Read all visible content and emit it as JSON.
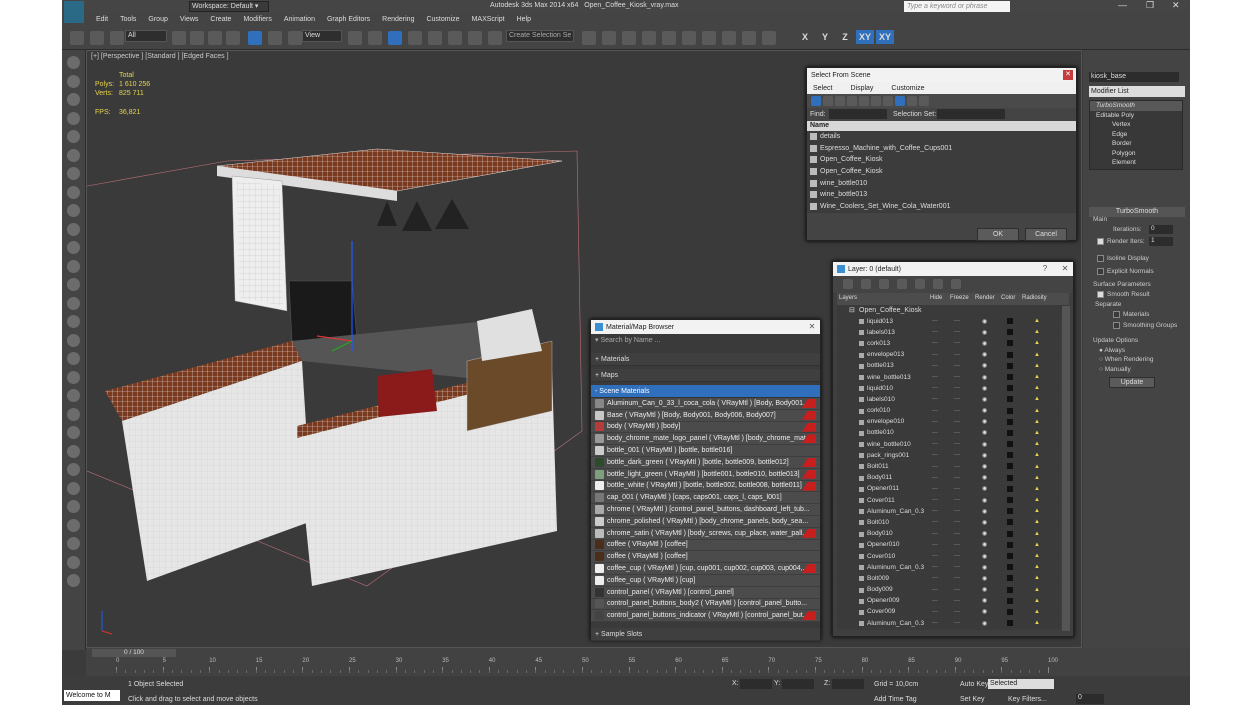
{
  "app": {
    "title": "Autodesk 3ds Max 2014 x64",
    "file": "Open_Coffee_Kiosk_vray.max",
    "workspace": "Workspace: Default",
    "search_placeholder": "Type a keyword or phrase"
  },
  "menu": [
    "Edit",
    "Tools",
    "Group",
    "Views",
    "Create",
    "Modifiers",
    "Animation",
    "Graph Editors",
    "Rendering",
    "Customize",
    "MAXScript",
    "Help"
  ],
  "toolbar": {
    "filter": "All",
    "refcoord": "View",
    "selset": "Create Selection Se",
    "axes": [
      "X",
      "Y",
      "Z",
      "XY",
      "XY"
    ]
  },
  "viewport": {
    "label": "[+] [Perspective ] [Standard ] [Edged Faces ]",
    "stats": {
      "total_label": "Total",
      "polys_label": "Polys:",
      "polys": "1 610 256",
      "verts_label": "Verts:",
      "verts": "825 711",
      "fps_label": "FPS:",
      "fps": "36,821"
    }
  },
  "select_dialog": {
    "title": "Select From Scene",
    "menu": [
      "Select",
      "Display",
      "Customize"
    ],
    "find_label": "Find:",
    "selset_label": "Selection Set:",
    "col_name": "Name",
    "items": [
      "details",
      "Espresso_Machine_with_Coffee_Cups001",
      "Open_Coffee_Kiosk",
      "Open_Coffee_Kiosk",
      "wine_bottle010",
      "wine_bottle013",
      "Wine_Coolers_Set_Wine_Cola_Water001"
    ],
    "ok": "OK",
    "cancel": "Cancel"
  },
  "material_browser": {
    "title": "Material/Map Browser",
    "search": "Search by Name ...",
    "sections": [
      "+ Materials",
      "+ Maps",
      "- Scene Materials"
    ],
    "footer": "+ Sample Slots",
    "materials": [
      "Aluminum_Can_0_33_l_coca_cola  ( VRayMtl ) [Body, Body001,...",
      "Base  ( VRayMtl ) [Body, Body001, Body006, Body007]",
      "body  ( VRayMtl ) [body]",
      "body_chrome_mate_logo_panel  ( VRayMtl ) [body_chrome_mat...",
      "bottle_001  ( VRayMtl ) [bottle, bottle016]",
      "bottle_dark_green  ( VRayMtl ) [bottle, bottle009, bottle012]",
      "bottle_light_green  ( VRayMtl ) [bottle001, bottle010, bottle013]",
      "bottle_white  ( VRayMtl ) [bottle, bottle002, bottle008, bottle011]",
      "cap_001  ( VRayMtl ) [caps, caps001, caps_l, caps_l001]",
      "chrome  ( VRayMtl ) [control_panel_buttons, dashboard_left_tub...",
      "chrome_polished  ( VRayMtl ) [body_chrome_panels, body_sea...",
      "chrome_satin  ( VRayMtl ) [body_screws, cup_place, water_pall...",
      "coffee  ( VRayMtl ) [coffee]",
      "coffee  ( VRayMtl ) [coffee]",
      "coffee_cup  ( VRayMtl ) [cup, cup001, cup002, cup003, cup004,...",
      "coffee_cup  ( VRayMtl ) [cup]",
      "control_panel  ( VRayMtl ) [control_panel]",
      "control_panel_buttons_body2  ( VRayMtl ) [control_panel_butto...",
      "control_panel_buttons_indicator  ( VRayMtl ) [control_panel_but..."
    ],
    "swatches": [
      "#888",
      "#c8c8c8",
      "#b43c3c",
      "#999",
      "#ccc",
      "#2d4a2d",
      "#7fa07f",
      "#eee",
      "#777",
      "#aaa",
      "#ccc",
      "#bbb",
      "#4a2d1a",
      "#4a2d1a",
      "#eee",
      "#eee",
      "#333",
      "#555",
      "#444"
    ],
    "red": [
      true,
      true,
      true,
      true,
      false,
      true,
      true,
      true,
      false,
      false,
      false,
      true,
      false,
      false,
      true,
      false,
      false,
      false,
      true
    ]
  },
  "layer_dialog": {
    "title": "Layer: 0 (default)",
    "cols": [
      "Layers",
      "Hide",
      "Freeze",
      "Render",
      "Color",
      "Radiosity"
    ],
    "root": "Open_Coffee_Kiosk",
    "items": [
      "liquid013",
      "labels013",
      "cork013",
      "envelope013",
      "bottle013",
      "wine_bottle013",
      "liquid010",
      "labels010",
      "cork010",
      "envelope010",
      "bottle010",
      "wine_bottle010",
      "pack_rings001",
      "Bolt011",
      "Body011",
      "Opener011",
      "Cover011",
      "Aluminum_Can_0.3",
      "Bolt010",
      "Body010",
      "Opener010",
      "Cover010",
      "Aluminum_Can_0.3",
      "Bolt009",
      "Body009",
      "Opener009",
      "Cover009",
      "Aluminum_Can_0.3"
    ]
  },
  "command_panel": {
    "object_name": "kiosk_base",
    "modifier_list": "Modifier List",
    "stack": [
      "TurboSmooth",
      "Editable Poly",
      "Vertex",
      "Edge",
      "Border",
      "Polygon",
      "Element"
    ],
    "turbosmooth": {
      "title": "TurboSmooth",
      "main": "Main",
      "iterations_label": "Iterations:",
      "iterations": "0",
      "render_iters_label": "Render Iters:",
      "render_iters": "1",
      "isoline": "Isoline Display",
      "explicit": "Explicit Normals",
      "surface": "Surface Parameters",
      "smooth": "Smooth Result",
      "separate": "Separate",
      "materials": "Materials",
      "smoothing": "Smoothing Groups",
      "update_opts": "Update Options",
      "always": "Always",
      "when_render": "When Rendering",
      "manually": "Manually",
      "update": "Update"
    }
  },
  "timeline": {
    "frame": "0 / 100",
    "ticks": [
      "0",
      "5",
      "10",
      "15",
      "20",
      "25",
      "30",
      "35",
      "40",
      "45",
      "50",
      "55",
      "60",
      "65",
      "70",
      "75",
      "80",
      "85",
      "90",
      "95",
      "100"
    ]
  },
  "status": {
    "welcome": "Welcome to M",
    "selected": "1 Object Selected",
    "prompt": "Click and drag to select and move objects",
    "x": "X:",
    "y": "Y:",
    "z": "Z:",
    "grid": "Grid = 10,0cm",
    "add_tag": "Add Time Tag",
    "autokey": "Auto Key",
    "setkey": "Set Key",
    "sel_mode": "Selected",
    "key_filters": "Key Filters...",
    "frame_num": "0"
  },
  "colors": {
    "accent": "#2f6fbb",
    "bg": "#3b3b3b",
    "wood": "#7a3a1f",
    "highlight": "#e8d44d"
  }
}
